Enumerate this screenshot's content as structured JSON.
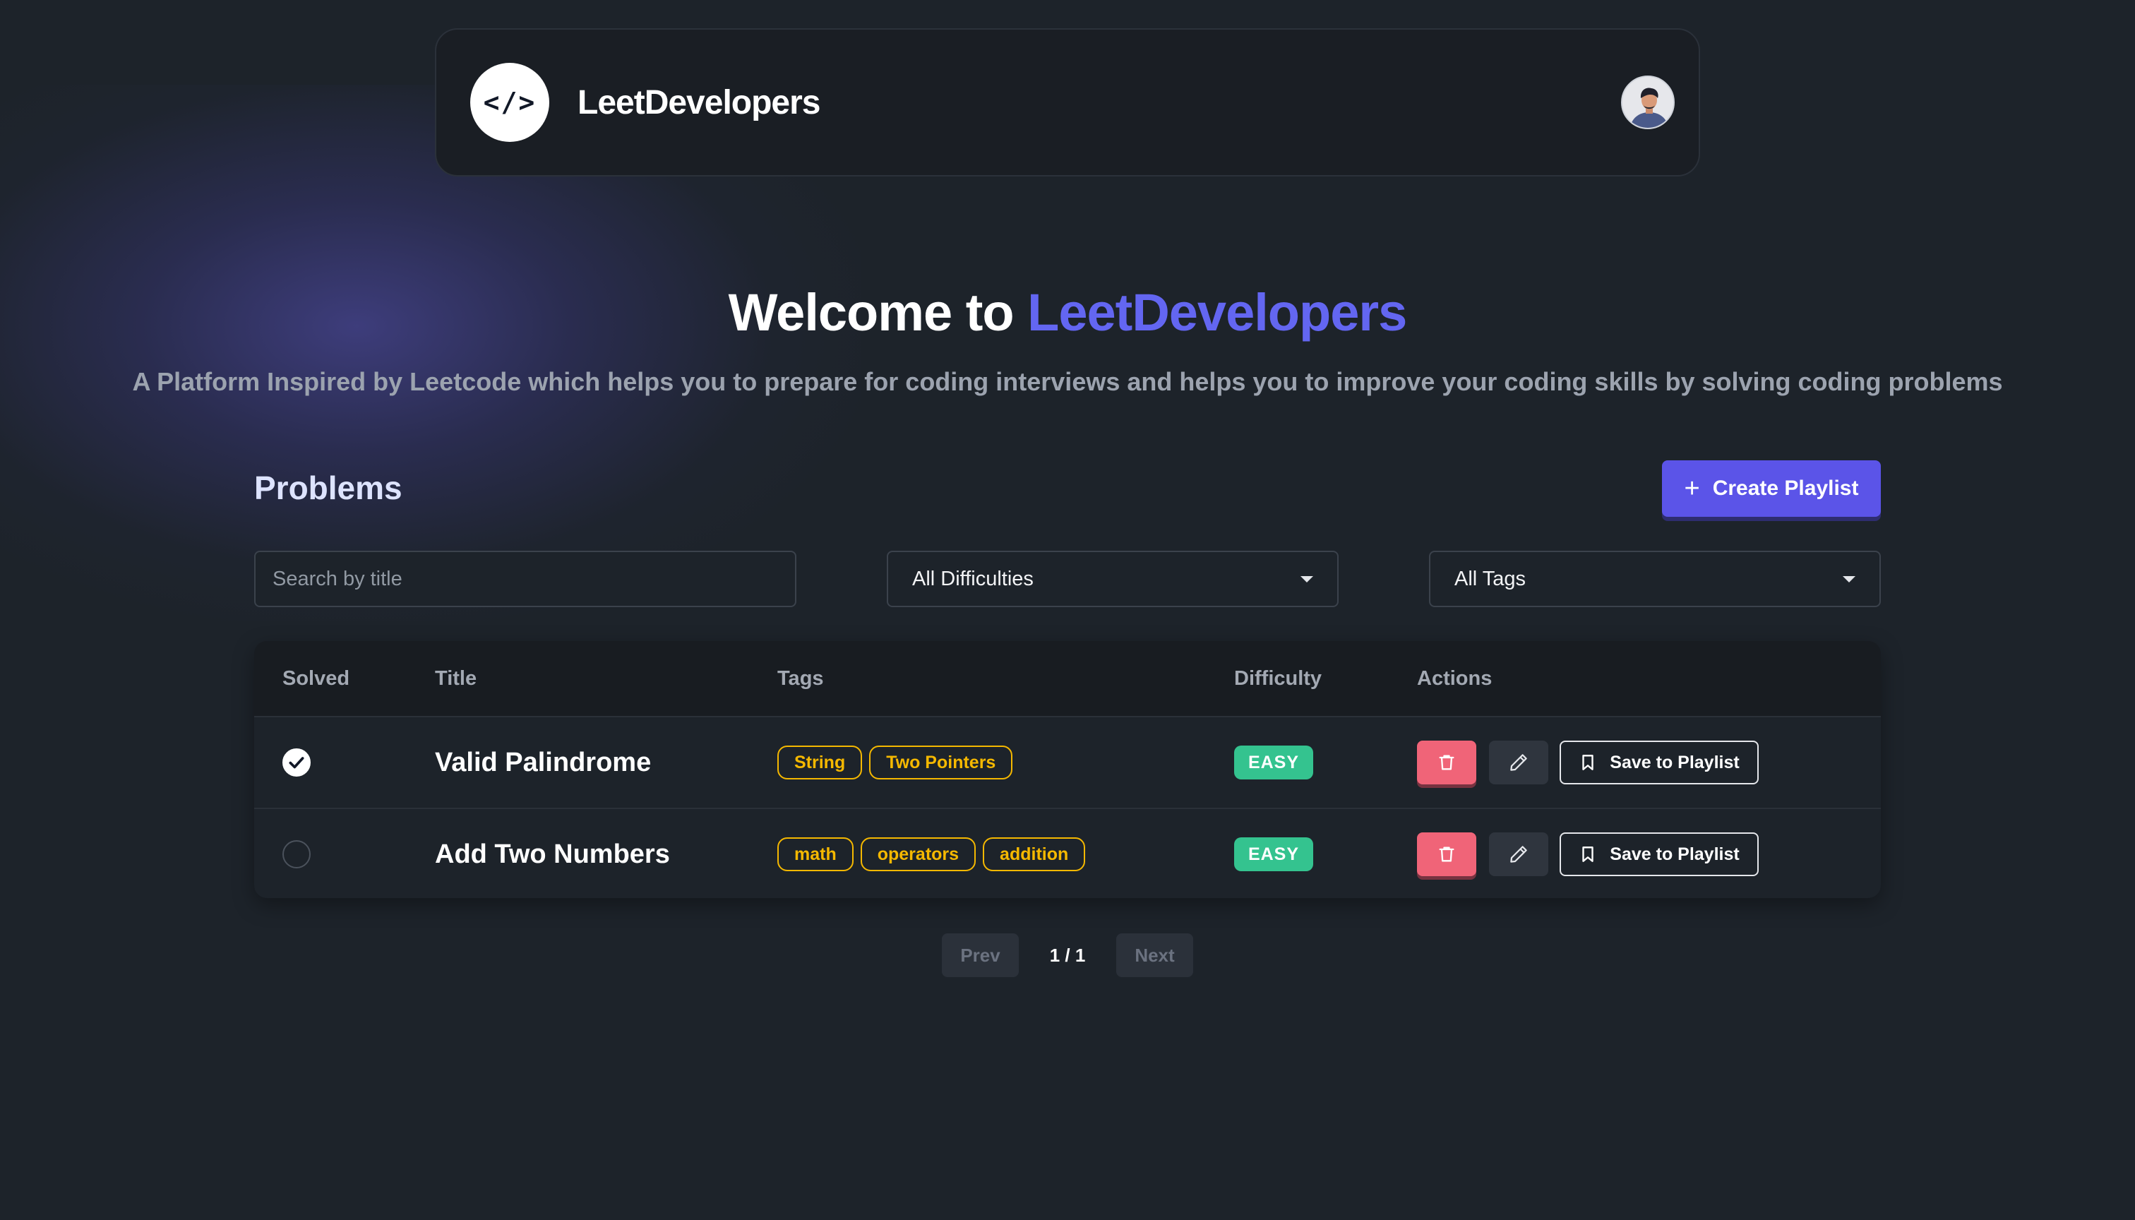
{
  "navbar": {
    "logo_text": "</>",
    "brand": "LeetDevelopers"
  },
  "hero": {
    "title_prefix": "Welcome to ",
    "title_accent": "LeetDevelopers",
    "subtitle": "A Platform Inspired by Leetcode which helps you to prepare for coding interviews and helps you to improve your coding skills by solving coding problems"
  },
  "problems": {
    "heading": "Problems",
    "create_playlist_label": "Create Playlist"
  },
  "filters": {
    "search_placeholder": "Search by title",
    "difficulty_selected": "All Difficulties",
    "tags_selected": "All Tags"
  },
  "table": {
    "headers": [
      "Solved",
      "Title",
      "Tags",
      "Difficulty",
      "Actions"
    ],
    "rows": [
      {
        "solved": true,
        "title": "Valid Palindrome",
        "tags": [
          "String",
          "Two Pointers"
        ],
        "difficulty": "EASY",
        "save_label": "Save to Playlist"
      },
      {
        "solved": false,
        "title": "Add Two Numbers",
        "tags": [
          "math",
          "operators",
          "addition"
        ],
        "difficulty": "EASY",
        "save_label": "Save to Playlist"
      }
    ]
  },
  "pagination": {
    "prev_label": "Prev",
    "page_info": "1 / 1",
    "next_label": "Next"
  },
  "colors": {
    "accent": "#6366f1",
    "primary_button": "#5b54e8",
    "tag": "#f5b800",
    "easy_badge": "#34c38f",
    "delete_button": "#f06478",
    "background": "#1d232a"
  },
  "icons": {
    "create": "plus-icon",
    "delete": "trash-icon",
    "edit": "pencil-icon",
    "save": "bookmark-icon",
    "solved": "check-icon",
    "dropdown": "caret-down-icon"
  }
}
